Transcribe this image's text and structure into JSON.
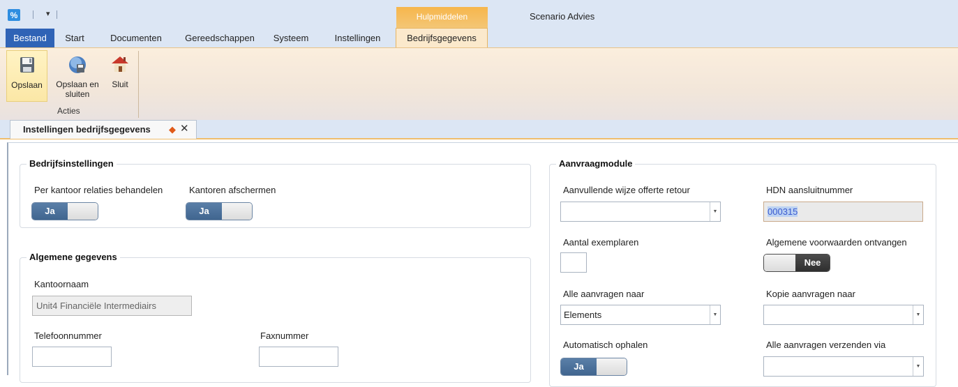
{
  "title_bar": {
    "app_icon_glyph": "%",
    "quick_access_dropdown": "▾",
    "context_header": "Hulpmiddelen",
    "window_title": "Scenario Advies"
  },
  "tabs": {
    "file": "Bestand",
    "start": "Start",
    "documenten": "Documenten",
    "gereedschappen": "Gereedschappen",
    "systeem": "Systeem",
    "instellingen": "Instellingen",
    "bedrijfsgegevens": "Bedrijfsgegevens"
  },
  "ribbon": {
    "save_label": "Opslaan",
    "save_close_label_1": "Opslaan en",
    "save_close_label_2": "sluiten",
    "close_label": "Sluit",
    "group_label": "Acties"
  },
  "document_tab": {
    "title": "Instellingen bedrijfsgegevens",
    "modified_marker": "◆",
    "close_glyph": "✕"
  },
  "bedrijfsinstellingen": {
    "title": "Bedrijfsinstellingen",
    "per_kantoor_label": "Per kantoor relaties behandelen",
    "per_kantoor_value": "Ja",
    "kantoren_label": "Kantoren afschermen",
    "kantoren_value": "Ja"
  },
  "algemene_gegevens": {
    "title": "Algemene gegevens",
    "kantoornaam_label": "Kantoornaam",
    "kantoornaam_value": "Unit4 Financiële Intermediairs",
    "telefoon_label": "Telefoonnummer",
    "telefoon_value": "",
    "fax_label": "Faxnummer",
    "fax_value": ""
  },
  "aanvraagmodule": {
    "title": "Aanvraagmodule",
    "wijze_label": "Aanvullende wijze offerte retour",
    "wijze_value": "",
    "hdn_label": "HDN aansluitnummer",
    "hdn_value": "000315",
    "exemplaren_label": "Aantal exemplaren",
    "exemplaren_value": "",
    "voorwaarden_label": "Algemene voorwaarden ontvangen",
    "voorwaarden_value": "Nee",
    "alle_naar_label": "Alle aanvragen naar",
    "alle_naar_value": "Elements",
    "kopie_label": "Kopie aanvragen naar",
    "kopie_value": "",
    "ophalen_label": "Automatisch ophalen",
    "ophalen_value": "Ja",
    "verzenden_label": "Alle aanvragen verzenden via",
    "verzenden_value": ""
  },
  "colors": {
    "ribbon_bg": "#dce6f4",
    "file_tab": "#2f63b6",
    "context_orange": "#f4b249",
    "toggle_blue": "#4a6e96"
  }
}
